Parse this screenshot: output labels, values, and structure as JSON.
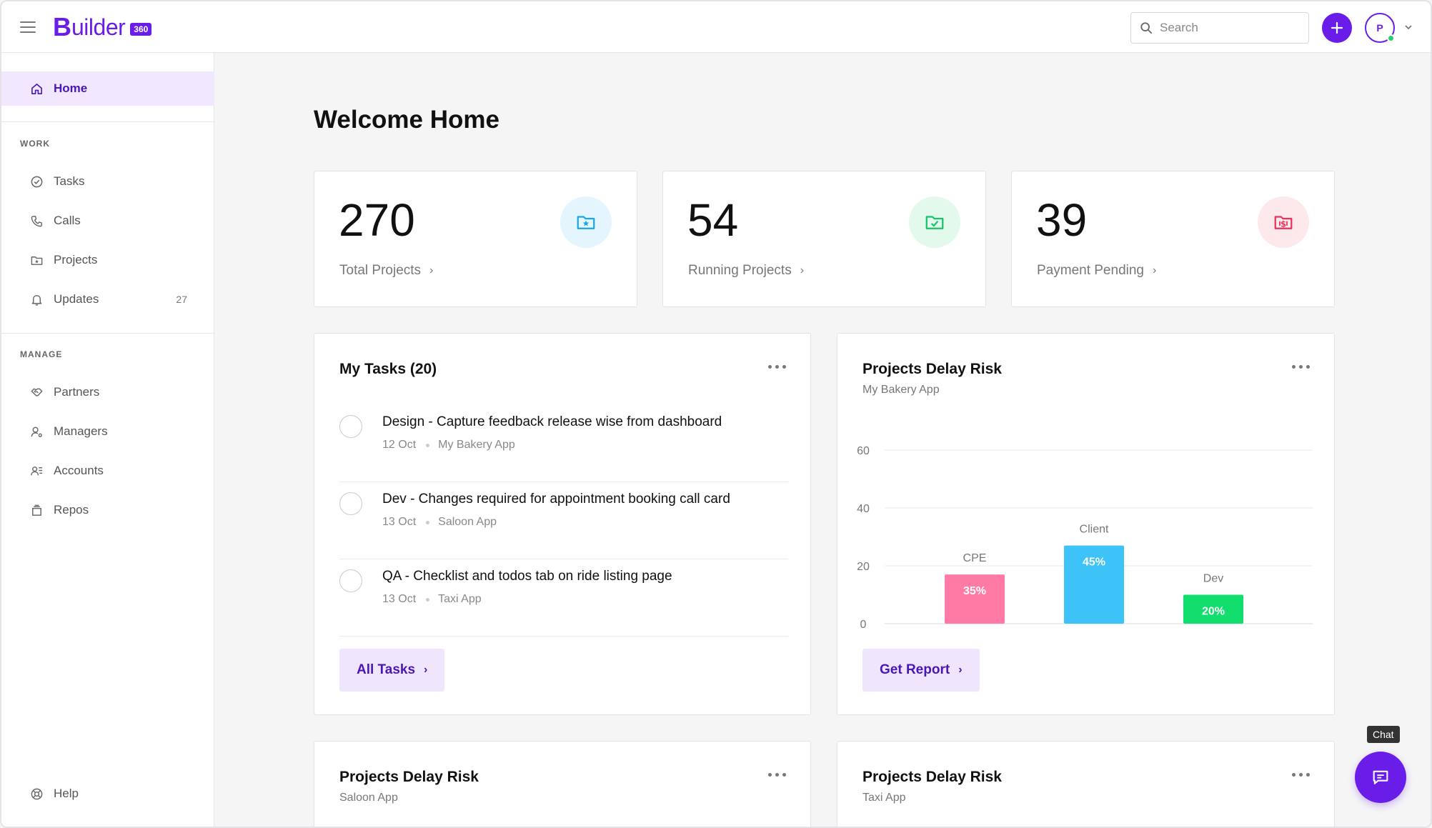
{
  "app": {
    "logo_b": "B",
    "logo_text": "uilder",
    "logo_badge": "360"
  },
  "header": {
    "search_placeholder": "Search",
    "avatar_initial": "P"
  },
  "sidebar": {
    "home_label": "Home",
    "work_title": "WORK",
    "work_items": [
      {
        "label": "Tasks",
        "icon": "check-circle-icon"
      },
      {
        "label": "Calls",
        "icon": "phone-icon"
      },
      {
        "label": "Projects",
        "icon": "folder-icon"
      },
      {
        "label": "Updates",
        "icon": "bell-icon",
        "count": "27"
      }
    ],
    "manage_title": "MANAGE",
    "manage_items": [
      {
        "label": "Partners",
        "icon": "handshake-icon"
      },
      {
        "label": "Managers",
        "icon": "user-gear-icon"
      },
      {
        "label": "Accounts",
        "icon": "accounts-icon"
      },
      {
        "label": "Repos",
        "icon": "box-icon"
      }
    ],
    "help_label": "Help"
  },
  "main": {
    "title": "Welcome Home",
    "stats": [
      {
        "value": "270",
        "label": "Total Projects",
        "icon": "folder-star-icon",
        "color": "#1aa8e0",
        "bg": "#e4f5fd"
      },
      {
        "value": "54",
        "label": "Running Projects",
        "icon": "folder-check-icon",
        "color": "#18c46a",
        "bg": "#e3f9ec"
      },
      {
        "value": "39",
        "label": "Payment Pending",
        "icon": "folder-dollar-icon",
        "color": "#e8345a",
        "bg": "#fde8ec"
      }
    ],
    "tasks_card": {
      "title": "My Tasks (20)",
      "tasks": [
        {
          "title": "Design - Capture feedback release wise from dashboard",
          "date": "12 Oct",
          "project": "My Bakery App"
        },
        {
          "title": "Dev - Changes required for appointment booking call card",
          "date": "13 Oct",
          "project": "Saloon App"
        },
        {
          "title": "QA - Checklist and todos tab on ride listing page",
          "date": "13 Oct",
          "project": "Taxi App"
        }
      ],
      "button": "All Tasks"
    },
    "risk_card": {
      "title": "Projects Delay Risk",
      "subtitle": "My Bakery App",
      "button": "Get Report"
    },
    "bottom_cards": [
      {
        "title": "Projects Delay Risk",
        "subtitle": "Saloon App"
      },
      {
        "title": "Projects Delay Risk",
        "subtitle": "Taxi App"
      }
    ],
    "chat_tooltip": "Chat"
  },
  "chart_data": {
    "type": "bar",
    "categories": [
      "CPE",
      "Client",
      "Dev"
    ],
    "values": [
      17,
      27,
      10
    ],
    "data_labels": [
      "35%",
      "45%",
      "20%"
    ],
    "colors": [
      "#ff7ba5",
      "#3ec3f9",
      "#12de6e"
    ],
    "yticks": [
      "0",
      "20",
      "40",
      "60"
    ],
    "ylim": [
      0,
      60
    ],
    "grid": true
  },
  "colors": {
    "accent": "#6a1ce8"
  }
}
